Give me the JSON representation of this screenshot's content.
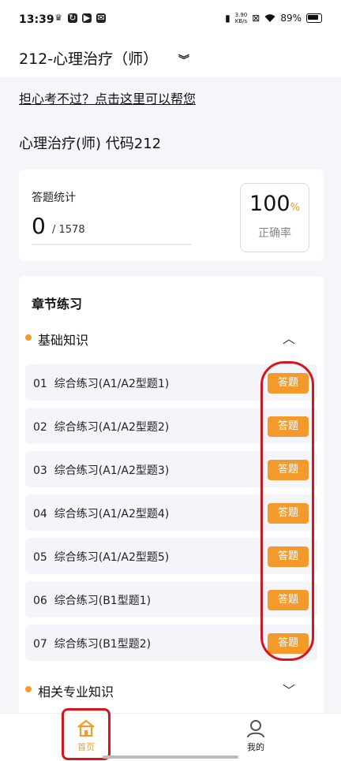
{
  "status_bar": {
    "time": "13:39",
    "net_speed_value": "3.90",
    "net_speed_unit": "KB/s",
    "battery": "89%"
  },
  "header": {
    "title": "212-心理治疗（师）"
  },
  "help_link": "担心考不过？点击这里可以帮您",
  "page_heading": "心理治疗(师) 代码212",
  "stats": {
    "label": "答题统计",
    "answered": "0",
    "total": "/ 1578",
    "accuracy_value": "100",
    "accuracy_unit": "%",
    "accuracy_label": "正确率"
  },
  "chapter": {
    "title": "章节练习",
    "sections": [
      {
        "name": "基础知识",
        "expanded": true,
        "items": [
          {
            "index": "01",
            "name": "综合练习(A1/A2型题1)",
            "button": "答题"
          },
          {
            "index": "02",
            "name": "综合练习(A1/A2型题2)",
            "button": "答题"
          },
          {
            "index": "03",
            "name": "综合练习(A1/A2型题3)",
            "button": "答题"
          },
          {
            "index": "04",
            "name": "综合练习(A1/A2型题4)",
            "button": "答题"
          },
          {
            "index": "05",
            "name": "综合练习(A1/A2型题5)",
            "button": "答题"
          },
          {
            "index": "06",
            "name": "综合练习(B1型题1)",
            "button": "答题"
          },
          {
            "index": "07",
            "name": "综合练习(B1型题2)",
            "button": "答题"
          }
        ]
      },
      {
        "name": "相关专业知识",
        "expanded": false
      }
    ]
  },
  "bottom_nav": [
    {
      "label": "首页",
      "active": true,
      "icon": "home-icon"
    },
    {
      "label": "我的",
      "active": false,
      "icon": "user-icon"
    }
  ],
  "colors": {
    "accent": "#f39a2b",
    "annotation": "#d6161c",
    "page_bg": "#f4f6fa"
  }
}
